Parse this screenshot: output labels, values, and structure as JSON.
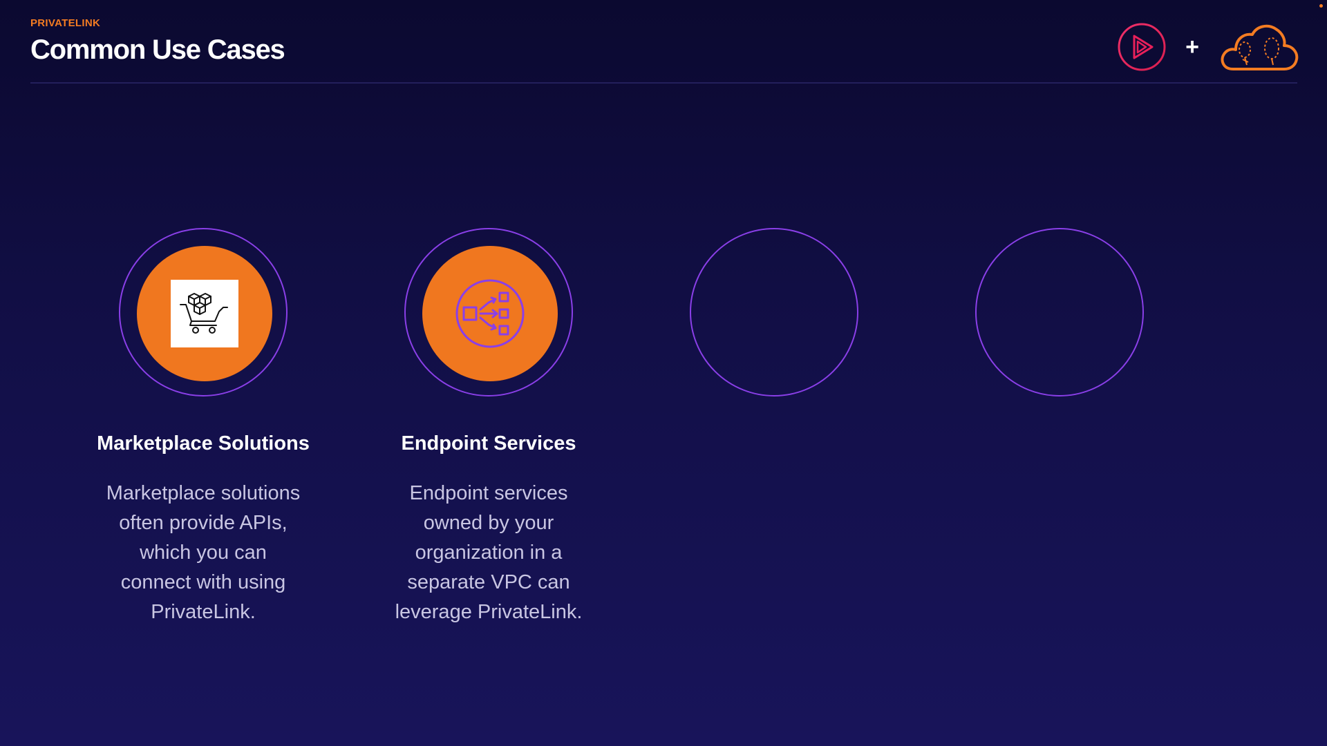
{
  "header": {
    "eyebrow": "PRIVATELINK",
    "title": "Common Use Cases",
    "plus_sign": "+"
  },
  "logos": [
    {
      "name": "pluralsight-play-icon",
      "color": "#e8205a"
    },
    {
      "name": "aws-cloud-guru-cloud-icon",
      "color": "#f47c22"
    }
  ],
  "colors": {
    "background_top": "#0b0930",
    "background_bottom": "#18145a",
    "accent_orange": "#f0771f",
    "ring_purple": "#8a3fe8"
  },
  "use_cases": [
    {
      "title": "Marketplace Solutions",
      "description": "Marketplace solutions often provide APIs, which you can connect with using PrivateLink.",
      "icon": "marketplace-cart-icon"
    },
    {
      "title": "Endpoint Services",
      "description": "Endpoint services owned by your organization in a separate VPC can leverage PrivateLink.",
      "icon": "endpoint-services-icon"
    },
    {
      "title": "",
      "description": "",
      "icon": ""
    },
    {
      "title": "",
      "description": "",
      "icon": ""
    }
  ]
}
